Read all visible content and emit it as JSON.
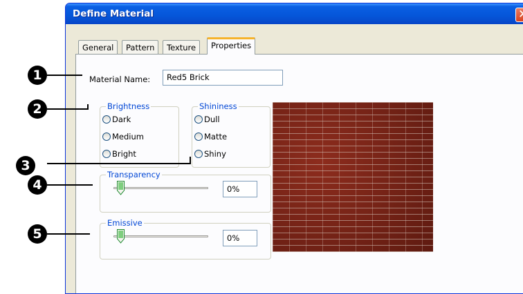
{
  "window": {
    "title": "Define Material",
    "close_glyph": "✕"
  },
  "tabs": [
    {
      "label": "General",
      "active": false
    },
    {
      "label": "Pattern",
      "active": false
    },
    {
      "label": "Texture",
      "active": false
    },
    {
      "label": "Properties",
      "active": true
    }
  ],
  "material_name": {
    "label": "Material Name:",
    "value": "Red5 Brick"
  },
  "brightness": {
    "title": "Brightness",
    "options": [
      "Dark",
      "Medium",
      "Bright"
    ],
    "selected": null
  },
  "shininess": {
    "title": "Shininess",
    "options": [
      "Dull",
      "Matte",
      "Shiny"
    ],
    "selected": null
  },
  "transparency": {
    "title": "Transparency",
    "slider_level": 0,
    "value": "0%"
  },
  "emissive": {
    "title": "Emissive",
    "slider_level": 0,
    "value": "0%"
  },
  "preview": {
    "texture": "red brick wall",
    "brick_color": "#7a2418",
    "mortar_color": "#d7c8be"
  },
  "callouts": [
    "1",
    "2",
    "3",
    "4",
    "5"
  ],
  "colors": {
    "titlebar": "#0556d9",
    "group_title": "#0046d5",
    "active_tab_accent": "#f6b32a",
    "dialog_bg": "#ece9d8"
  }
}
